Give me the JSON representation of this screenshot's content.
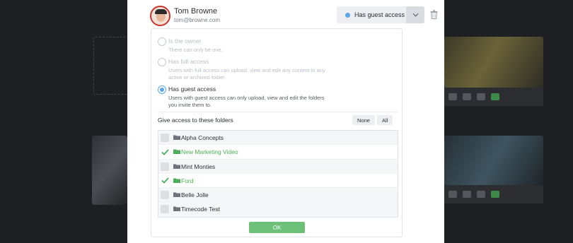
{
  "user": {
    "name": "Tom Browne",
    "email": "tom@browne.com"
  },
  "access": {
    "current_label": "Has guest access",
    "accent_color": "#5aa9e6"
  },
  "options": [
    {
      "title": "Is the owner",
      "description": "There can only be one.",
      "selected": false,
      "disabled": true
    },
    {
      "title": "Has full access",
      "description": "Users with full access can upload, view and edit any content in any active or archived folder.",
      "selected": false,
      "disabled": true
    },
    {
      "title": "Has guest access",
      "description": "Users with guest access can only upload, view and edit the folders you invite them to.",
      "selected": true,
      "disabled": false
    }
  ],
  "folders_section": {
    "label": "Give access to these folders",
    "none_label": "None",
    "all_label": "All",
    "items": [
      {
        "name": "Alpha Concepts",
        "checked": false
      },
      {
        "name": "New Marketing Video",
        "checked": true
      },
      {
        "name": "Mint Monties",
        "checked": false
      },
      {
        "name": "Ford",
        "checked": true
      },
      {
        "name": "Belle Jolle",
        "checked": false
      },
      {
        "name": "Timecode Test",
        "checked": false
      }
    ]
  },
  "ok_label": "OK",
  "colors": {
    "checked_green": "#4caf58",
    "ok_button": "#6cc078"
  },
  "icons": [
    "trash-icon",
    "chevron-down-icon",
    "folder-icon",
    "check-icon"
  ]
}
